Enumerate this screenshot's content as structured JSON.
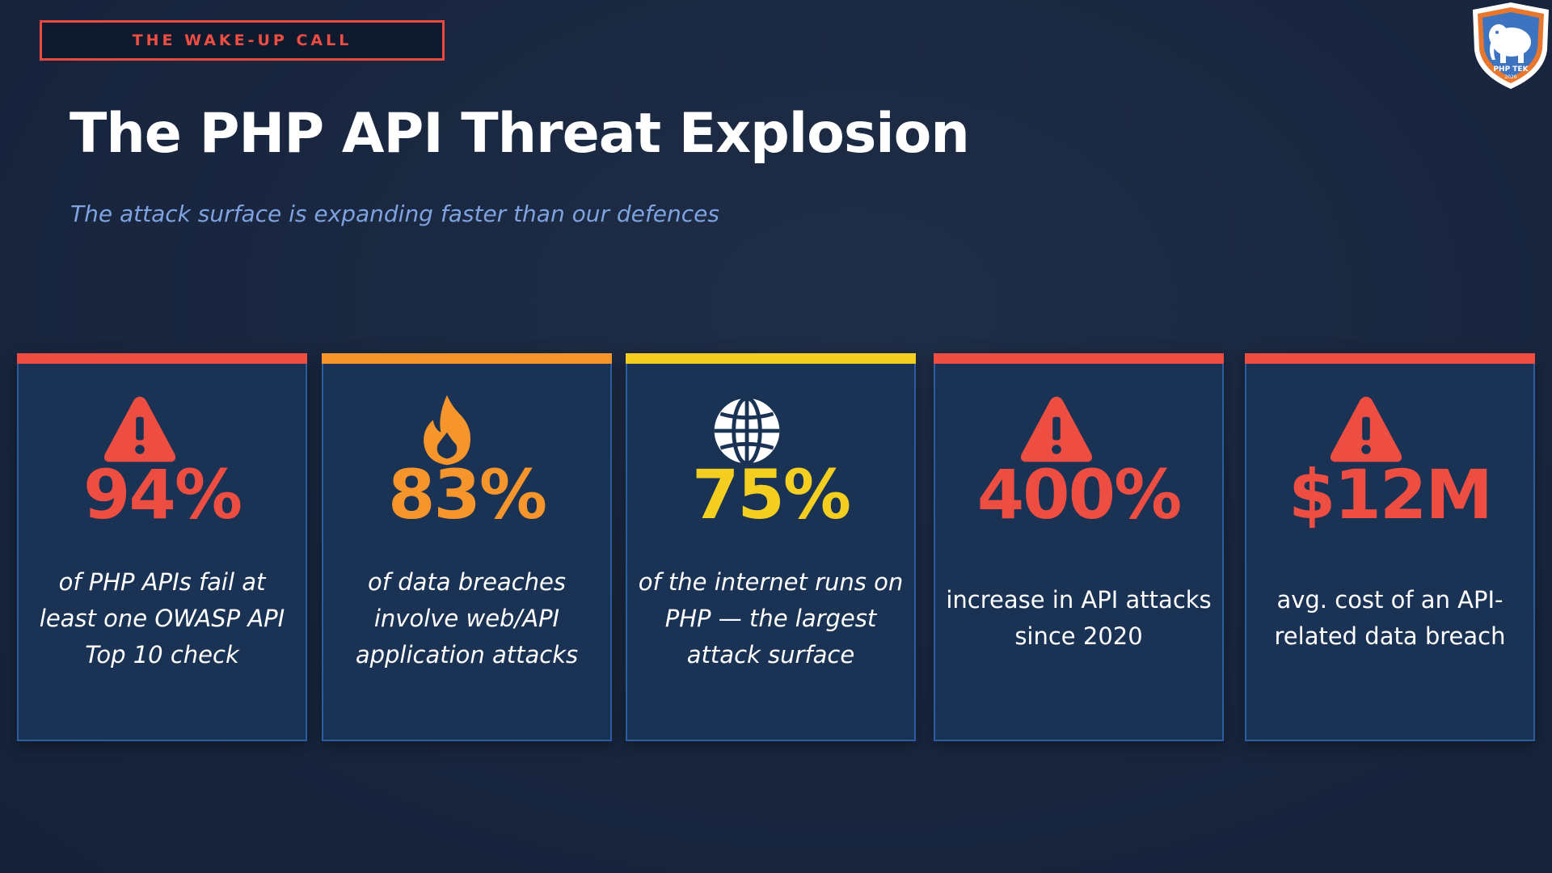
{
  "slide": {
    "section_tag": "THE WAKE-UP CALL",
    "title": "The PHP API Threat Explosion",
    "subtitle": "The attack surface is expanding faster than our defences",
    "logo": {
      "icon": "elephant-shield-logo",
      "text": "PHP TEK",
      "year": "2026"
    }
  },
  "colors": {
    "background": "#1a2740",
    "card_background": "#1a3354",
    "red": "#ee4d41",
    "orange": "#f6952b",
    "yellow": "#f4cf20",
    "subtitle": "#7fa2e0"
  },
  "stats": [
    {
      "icon": "warning-icon",
      "value": "94%",
      "description": "of PHP APIs fail at least one OWASP API Top 10 check",
      "accent": "#ee4d41",
      "bar": "#ee4d41",
      "italic": true
    },
    {
      "icon": "flame-icon",
      "value": "83%",
      "description": "of data breaches involve web/API application attacks",
      "accent": "#f6952b",
      "bar": "#f6952b",
      "italic": true
    },
    {
      "icon": "globe-icon",
      "value": "75%",
      "description": "of the internet runs on PHP — the largest attack surface",
      "accent": "#f4cf20",
      "bar": "#f4cf20",
      "italic": true
    },
    {
      "icon": "warning-icon",
      "value": "400%",
      "description": "increase in API attacks since 2020",
      "accent": "#ee4d41",
      "bar": "#ee4d41",
      "italic": false
    },
    {
      "icon": "warning-icon",
      "value": "$12M",
      "description": "avg. cost of an API-related data breach",
      "accent": "#ee4d41",
      "bar": "#ee4d41",
      "italic": false
    }
  ]
}
